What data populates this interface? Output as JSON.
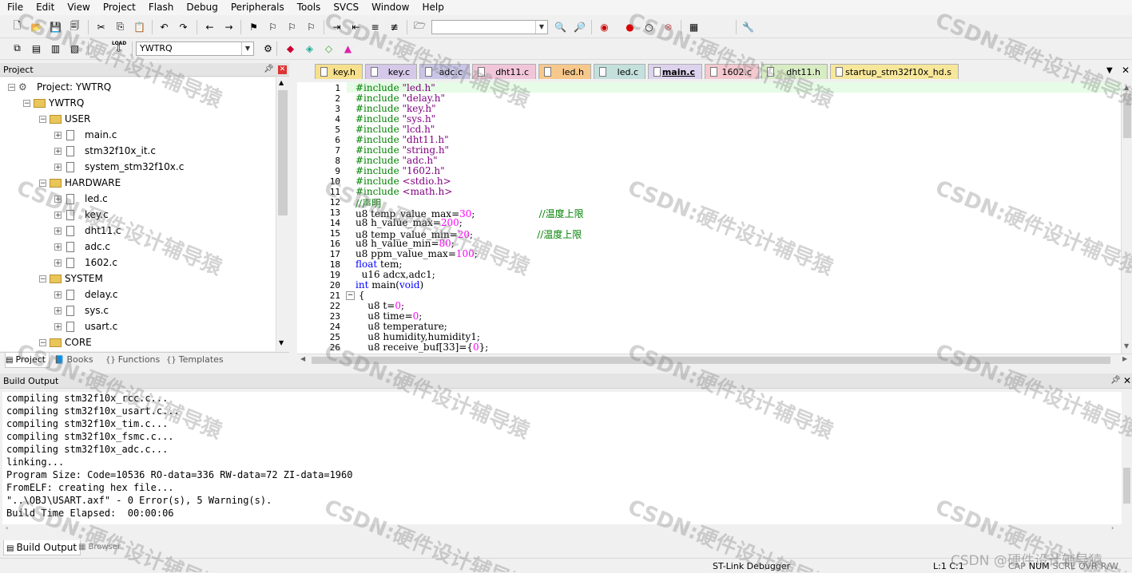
{
  "menu": [
    "File",
    "Edit",
    "View",
    "Project",
    "Flash",
    "Debug",
    "Peripherals",
    "Tools",
    "SVCS",
    "Window",
    "Help"
  ],
  "toolbar": {
    "target_combo": "YWTRQ",
    "icons": [
      "new-file-icon",
      "open-icon",
      "save-icon",
      "save-all-icon",
      "cut-icon",
      "copy-icon",
      "paste-icon",
      "undo-icon",
      "redo-icon",
      "nav-back-icon",
      "nav-forward-icon",
      "bookmark-icon",
      "prev-bookmark-icon",
      "next-bookmark-icon",
      "clear-bookmarks-icon",
      "indent-icon",
      "unindent-icon",
      "comment-icon",
      "uncomment-icon",
      "find-in-files-icon",
      "find-icon",
      "incremental-find-icon",
      "debug-icon",
      "breakpoint-icon",
      "disable-breakpoint-icon",
      "kill-breakpoints-icon",
      "window-layout-icon",
      "configure-icon"
    ],
    "build_icons": [
      "translate-icon",
      "build-icon",
      "rebuild-icon",
      "batch-build-icon",
      "download-icon",
      "target-options-icon",
      "manage-components-icon",
      "pack-installer-icon",
      "event-recorder-icon",
      "select-packs-icon"
    ],
    "load_label": "LOAD"
  },
  "project_panel": {
    "title": "Project",
    "tree": [
      {
        "label": "Project: YWTRQ",
        "level": 0,
        "type": "project",
        "expanded": true
      },
      {
        "label": "YWTRQ",
        "level": 1,
        "type": "target",
        "expanded": true
      },
      {
        "label": "USER",
        "level": 2,
        "type": "group",
        "expanded": true
      },
      {
        "label": "main.c",
        "level": 3,
        "type": "file"
      },
      {
        "label": "stm32f10x_it.c",
        "level": 3,
        "type": "file"
      },
      {
        "label": "system_stm32f10x.c",
        "level": 3,
        "type": "file"
      },
      {
        "label": "HARDWARE",
        "level": 2,
        "type": "group",
        "expanded": true
      },
      {
        "label": "led.c",
        "level": 3,
        "type": "file"
      },
      {
        "label": "key.c",
        "level": 3,
        "type": "file"
      },
      {
        "label": "dht11.c",
        "level": 3,
        "type": "file"
      },
      {
        "label": "adc.c",
        "level": 3,
        "type": "file"
      },
      {
        "label": "1602.c",
        "level": 3,
        "type": "file"
      },
      {
        "label": "SYSTEM",
        "level": 2,
        "type": "group",
        "expanded": true
      },
      {
        "label": "delay.c",
        "level": 3,
        "type": "file"
      },
      {
        "label": "sys.c",
        "level": 3,
        "type": "file"
      },
      {
        "label": "usart.c",
        "level": 3,
        "type": "file"
      },
      {
        "label": "CORE",
        "level": 2,
        "type": "group",
        "expanded": true
      }
    ],
    "bottom_tabs": [
      "Project",
      "Books",
      "Functions",
      "Templates"
    ]
  },
  "editor": {
    "tabs": [
      {
        "label": "key.h",
        "color": "#f7e08c",
        "active": false
      },
      {
        "label": "key.c",
        "color": "#d5c8e8",
        "active": false
      },
      {
        "label": "adc.c",
        "color": "#c9c5e6",
        "active": false
      },
      {
        "label": "dht11.c",
        "color": "#f1c6d9",
        "active": false
      },
      {
        "label": "led.h",
        "color": "#f7c88c",
        "active": false
      },
      {
        "label": "led.c",
        "color": "#c3e0dc",
        "active": false
      },
      {
        "label": "main.c",
        "color": "#ddd3ee",
        "active": true
      },
      {
        "label": "1602.c",
        "color": "#f4c8cf",
        "active": false
      },
      {
        "label": "dht11.h",
        "color": "#d8ecc4",
        "active": false
      },
      {
        "label": "startup_stm32f10x_hd.s",
        "color": "#f7e79a",
        "active": false
      }
    ],
    "lines": [
      {
        "n": "1",
        "t": "#include \"led.h\""
      },
      {
        "n": "2",
        "t": "#include \"delay.h\""
      },
      {
        "n": "3",
        "t": "#include \"key.h\""
      },
      {
        "n": "4",
        "t": "#include \"sys.h\""
      },
      {
        "n": "5",
        "t": "#include \"lcd.h\""
      },
      {
        "n": "6",
        "t": "#include \"dht11.h\""
      },
      {
        "n": "7",
        "t": "#include \"string.h\""
      },
      {
        "n": "8",
        "t": "#include \"adc.h\""
      },
      {
        "n": "9",
        "t": "#include \"1602.h\""
      },
      {
        "n": "10",
        "t": "#include <stdio.h>"
      },
      {
        "n": "11",
        "t": "#include <math.h>"
      },
      {
        "n": "12",
        "t": "//声明"
      },
      {
        "n": "13",
        "t": "u8 temp_value_max=30;                     //温度上限"
      },
      {
        "n": "14",
        "t": "u8 h_value_max=200;"
      },
      {
        "n": "15",
        "t": "u8 temp_value_min=20;                     //温度上限"
      },
      {
        "n": "16",
        "t": "u8 h_value_min=80;"
      },
      {
        "n": "17",
        "t": "u8 ppm_value_max=100;"
      },
      {
        "n": "18",
        "t": "float tem;"
      },
      {
        "n": "19",
        "t": "  u16 adcx,adc1;"
      },
      {
        "n": "20",
        "t": "int main(void)"
      },
      {
        "n": "21",
        "t": " {"
      },
      {
        "n": "22",
        "t": "    u8 t=0;"
      },
      {
        "n": "23",
        "t": "    u8 time=0;"
      },
      {
        "n": "24",
        "t": "    u8 temperature;"
      },
      {
        "n": "25",
        "t": "    u8 humidity,humidity1;"
      },
      {
        "n": "26",
        "t": "    u8 receive_buf[33]={0};"
      }
    ]
  },
  "build_output": {
    "title": "Build Output",
    "lines": [
      "compiling stm32f10x_rcc.c...",
      "compiling stm32f10x_usart.c...",
      "compiling stm32f10x_tim.c...",
      "compiling stm32f10x_fsmc.c...",
      "compiling stm32f10x_adc.c...",
      "linking...",
      "Program Size: Code=10536 RO-data=336 RW-data=72 ZI-data=1960",
      "FromELF: creating hex file...",
      "\"..\\OBJ\\USART.axf\" - 0 Error(s), 5 Warning(s).",
      "Build Time Elapsed:  00:00:06"
    ],
    "tabs": [
      "Build Output",
      "Browser"
    ]
  },
  "status": {
    "debugger": "ST-Link Debugger",
    "position": "L:1 C:1",
    "indicators": [
      "CAP",
      "NUM",
      "SCRL",
      "OVR",
      "R/W"
    ]
  },
  "watermark": {
    "text": "CSDN:硬件设计辅导猿",
    "signature": "CSDN @硬件设计辅导猿"
  }
}
